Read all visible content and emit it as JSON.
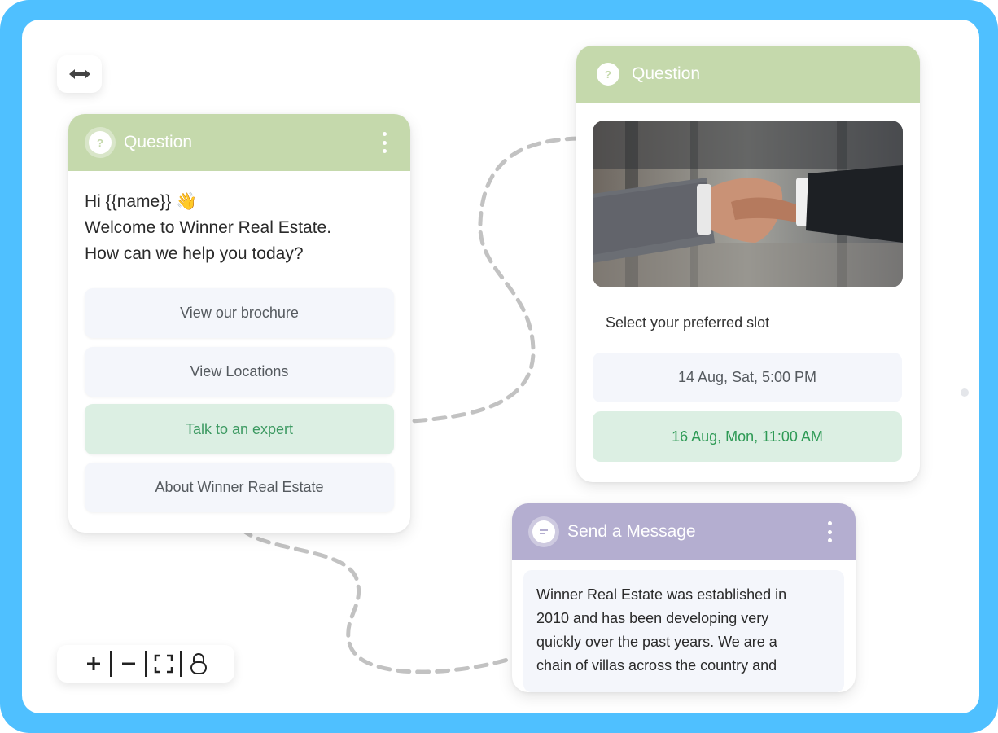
{
  "colors": {
    "frame": "#4fc0ff",
    "question_header": "#c5d9ac",
    "message_header": "#b4aed0",
    "selected_bg": "#dcefe3",
    "selected_text": "#3d9a62",
    "option_bg": "#f4f6fb"
  },
  "toolbar": {
    "expand_icon": "arrows-horizontal-icon",
    "zoom_in_icon": "plus-icon",
    "zoom_out_icon": "minus-icon",
    "fit_icon": "fit-screen-icon",
    "lock_icon": "lock-icon"
  },
  "card_question_1": {
    "title": "Question",
    "greeting_line1": "Hi {{name}} 👋",
    "greeting_line2": "Welcome to Winner Real Estate.",
    "greeting_line3": "How can we help you today?",
    "options": [
      {
        "label": "View our brochure",
        "selected": false
      },
      {
        "label": "View Locations",
        "selected": false
      },
      {
        "label": "Talk to an expert",
        "selected": true
      },
      {
        "label": "About Winner Real Estate",
        "selected": false
      }
    ]
  },
  "card_question_2": {
    "title": "Question",
    "image_subject": "handshake-photo",
    "prompt": "Select your preferred slot",
    "slots": [
      {
        "label": "14 Aug, Sat, 5:00 PM",
        "selected": false
      },
      {
        "label": "16 Aug, Mon, 11:00 AM",
        "selected": true
      }
    ]
  },
  "card_message": {
    "title": "Send a Message",
    "body_lines": [
      "Winner Real Estate was established in",
      "2010 and has been developing very",
      "quickly over the past years. We are a",
      "chain of villas across the country and"
    ]
  }
}
